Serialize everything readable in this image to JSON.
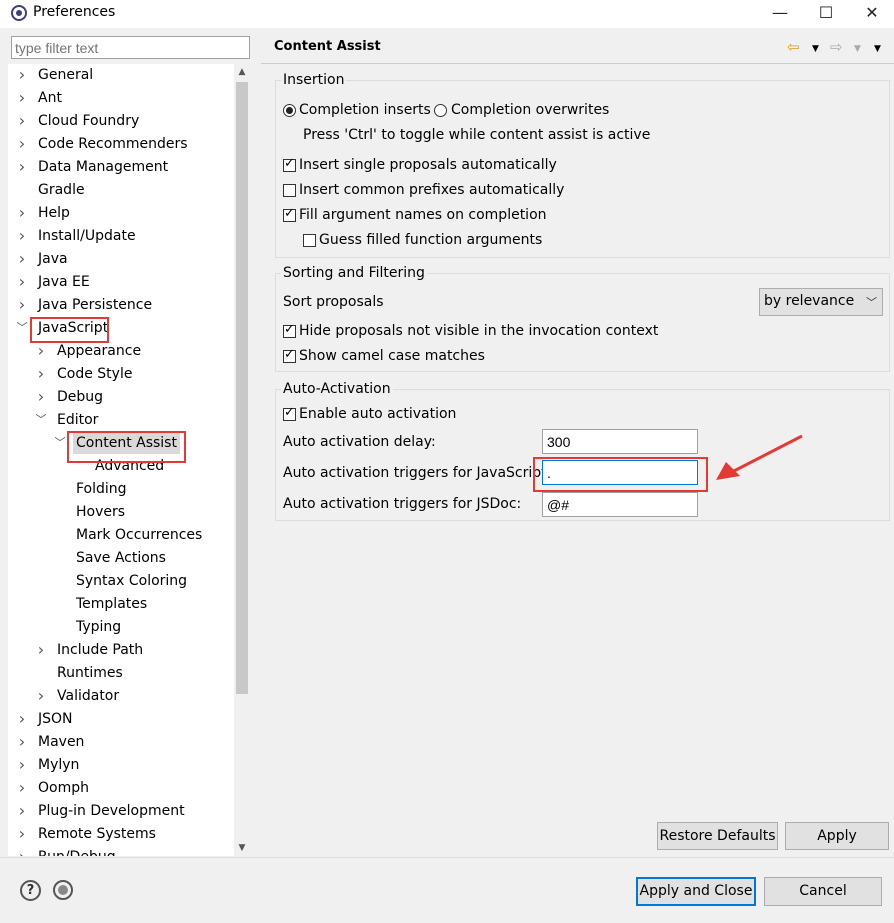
{
  "window": {
    "title": "Preferences",
    "minimize": "—",
    "maximize": "☐",
    "close": "✕"
  },
  "filter": {
    "placeholder": "type filter text"
  },
  "tree": {
    "items": [
      {
        "label": "General"
      },
      {
        "label": "Ant"
      },
      {
        "label": "Cloud Foundry"
      },
      {
        "label": "Code Recommenders"
      },
      {
        "label": "Data Management"
      },
      {
        "label": "Gradle"
      },
      {
        "label": "Help"
      },
      {
        "label": "Install/Update"
      },
      {
        "label": "Java"
      },
      {
        "label": "Java EE"
      },
      {
        "label": "Java Persistence"
      },
      {
        "label": "JavaScript"
      },
      {
        "label": "Appearance"
      },
      {
        "label": "Code Style"
      },
      {
        "label": "Debug"
      },
      {
        "label": "Editor"
      },
      {
        "label": "Content Assist"
      },
      {
        "label": "Advanced"
      },
      {
        "label": "Folding"
      },
      {
        "label": "Hovers"
      },
      {
        "label": "Mark Occurrences"
      },
      {
        "label": "Save Actions"
      },
      {
        "label": "Syntax Coloring"
      },
      {
        "label": "Templates"
      },
      {
        "label": "Typing"
      },
      {
        "label": "Include Path"
      },
      {
        "label": "Runtimes"
      },
      {
        "label": "Validator"
      },
      {
        "label": "JSON"
      },
      {
        "label": "Maven"
      },
      {
        "label": "Mylyn"
      },
      {
        "label": "Oomph"
      },
      {
        "label": "Plug-in Development"
      },
      {
        "label": "Remote Systems"
      },
      {
        "label": "Run/Debug"
      }
    ]
  },
  "page": {
    "title": "Content Assist"
  },
  "insertion": {
    "legend": "Insertion",
    "completion_inserts": "Completion inserts",
    "completion_overwrites": "Completion overwrites",
    "toggle_hint": "Press 'Ctrl' to toggle while content assist is active",
    "insert_single": "Insert single proposals automatically",
    "insert_common": "Insert common prefixes automatically",
    "fill_args": "Fill argument names on completion",
    "guess_args": "Guess filled function arguments"
  },
  "sorting": {
    "legend": "Sorting and Filtering",
    "sort_label": "Sort proposals",
    "sort_value": "by relevance",
    "hide_proposals": "Hide proposals not visible in the invocation context",
    "camel_case": "Show camel case matches"
  },
  "auto": {
    "legend": "Auto-Activation",
    "enable": "Enable auto activation",
    "delay_label": "Auto activation delay:",
    "delay_value": "300",
    "js_label": "Auto activation triggers for JavaScript:",
    "js_value": ".",
    "jsdoc_label": "Auto activation triggers for JSDoc:",
    "jsdoc_value": "@#"
  },
  "buttons": {
    "restore": "Restore Defaults",
    "apply": "Apply",
    "apply_close": "Apply and Close",
    "cancel": "Cancel"
  },
  "colors": {
    "highlight": "#e53935",
    "focus": "#0078d7"
  }
}
